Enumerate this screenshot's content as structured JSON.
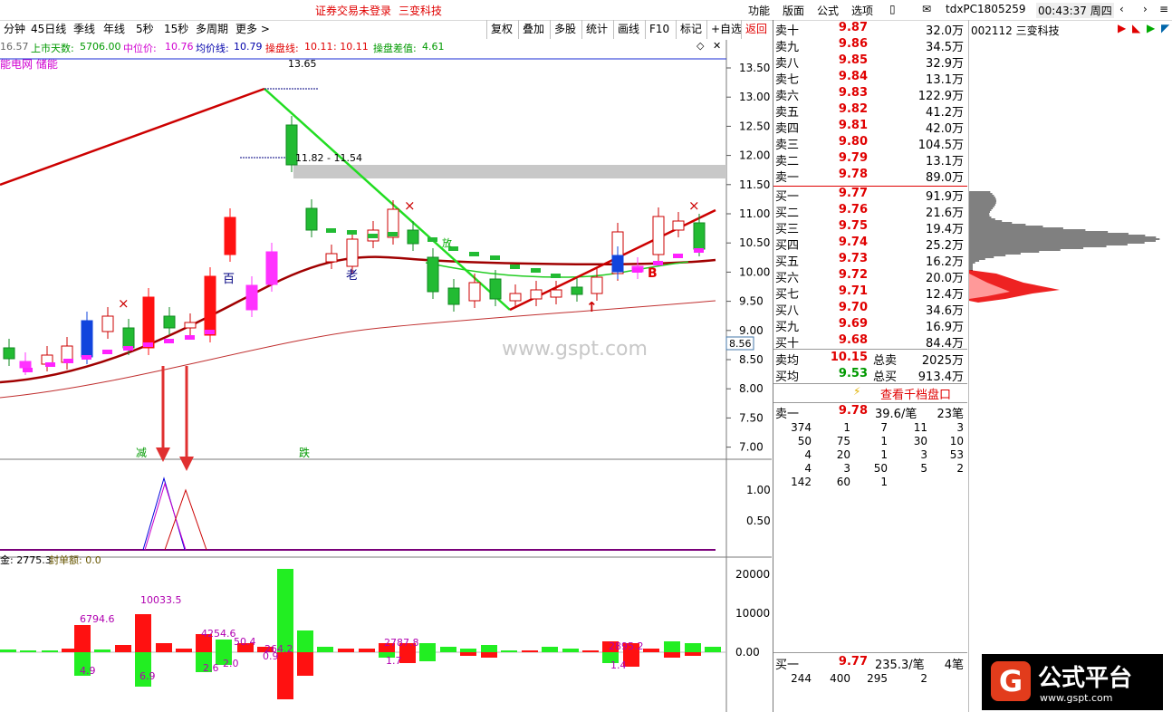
{
  "topbar": {
    "center_left": "证券交易未登录",
    "center_right": "三变科技",
    "menus": [
      "功能",
      "版面",
      "公式",
      "选项"
    ],
    "device_id": "tdxPC1805259",
    "clock": "00:43:37 周四"
  },
  "periods": [
    "分钟",
    "45日线",
    "季线",
    "年线",
    "5秒",
    "15秒",
    "多周期",
    "更多 >"
  ],
  "tools": [
    "复权",
    "叠加",
    "多股",
    "统计",
    "画线",
    "F10",
    "标记",
    "+自选",
    "返回"
  ],
  "info": {
    "price_prefix": "16.57",
    "days_label": "上市天数:",
    "days_value": "5706.00",
    "mid_label": "中位价:",
    "mid_value": "10.76",
    "avg_label": "均价线:",
    "avg_value": "10.79",
    "line_label": "操盘线:",
    "line_value": "10.11",
    "line_value2": ": 10.11",
    "diff_label": "操盘差值:",
    "diff_value": "4.61",
    "sector": "能电网 储能"
  },
  "chart": {
    "y_ticks": [
      "13.50",
      "13.00",
      "12.50",
      "12.00",
      "11.50",
      "11.00",
      "10.50",
      "10.00",
      "9.50",
      "9.00",
      "8.50",
      "8.00",
      "7.50",
      "7.00"
    ],
    "hi_label": "13.65",
    "range_label": "11.82 - 11.54",
    "current_price_tag": "8.56",
    "watermark": "www.gspt.com",
    "marks": {
      "bai": "百",
      "lao": "老",
      "b": "B",
      "fang": "放",
      "jian": "减",
      "die": "跌",
      "x": "×",
      "up": "↑"
    },
    "ind_ticks": [
      "1.00",
      "0.50"
    ],
    "vol_label_a": "金: 2775.3",
    "vol_label_b": "封单额: 0.0",
    "vol_ticks": [
      "20000",
      "10000",
      "0.00"
    ],
    "vol_values": [
      "6794.6",
      "10033.5",
      "4254.6",
      "50.4",
      "264.2",
      "2787.8",
      "2895.2",
      "4.9",
      "6.9",
      "2.6",
      "2.0",
      "0.9",
      "1.7",
      "1.4"
    ]
  },
  "book": {
    "code": "002112 三变科技",
    "sells": [
      {
        "name": "卖十",
        "price": "9.87",
        "vol": "32.0万"
      },
      {
        "name": "卖九",
        "price": "9.86",
        "vol": "34.5万"
      },
      {
        "name": "卖八",
        "price": "9.85",
        "vol": "32.9万"
      },
      {
        "name": "卖七",
        "price": "9.84",
        "vol": "13.1万"
      },
      {
        "name": "卖六",
        "price": "9.83",
        "vol": "122.9万"
      },
      {
        "name": "卖五",
        "price": "9.82",
        "vol": "41.2万"
      },
      {
        "name": "卖四",
        "price": "9.81",
        "vol": "42.0万"
      },
      {
        "name": "卖三",
        "price": "9.80",
        "vol": "104.5万"
      },
      {
        "name": "卖二",
        "price": "9.79",
        "vol": "13.1万"
      },
      {
        "name": "卖一",
        "price": "9.78",
        "vol": "89.0万"
      }
    ],
    "buys": [
      {
        "name": "买一",
        "price": "9.77",
        "vol": "91.9万"
      },
      {
        "name": "买二",
        "price": "9.76",
        "vol": "21.6万"
      },
      {
        "name": "买三",
        "price": "9.75",
        "vol": "19.4万"
      },
      {
        "name": "买四",
        "price": "9.74",
        "vol": "25.2万"
      },
      {
        "name": "买五",
        "price": "9.73",
        "vol": "16.2万"
      },
      {
        "name": "买六",
        "price": "9.72",
        "vol": "20.0万"
      },
      {
        "name": "买七",
        "price": "9.71",
        "vol": "12.4万"
      },
      {
        "name": "买八",
        "price": "9.70",
        "vol": "34.6万"
      },
      {
        "name": "买九",
        "price": "9.69",
        "vol": "16.9万"
      },
      {
        "name": "买十",
        "price": "9.68",
        "vol": "84.4万"
      }
    ],
    "sell_avg_label": "卖均",
    "sell_avg": "10.15",
    "sell_total_label": "总卖",
    "sell_total": "2025万",
    "buy_avg_label": "买均",
    "buy_avg": "9.53",
    "buy_total_label": "总买",
    "buy_total": "913.4万",
    "thousand_link": "查看千档盘口",
    "ask1_label": "卖一",
    "ask1_price": "9.78",
    "ask1_per": "39.6/笔",
    "ask1_count": "23笔",
    "ask_queue": [
      [
        "374",
        "1",
        "7",
        "11",
        "3"
      ],
      [
        "50",
        "75",
        "1",
        "30",
        "10"
      ],
      [
        "4",
        "20",
        "1",
        "3",
        "53"
      ],
      [
        "4",
        "3",
        "50",
        "5",
        "2"
      ],
      [
        "142",
        "60",
        "1",
        "",
        ""
      ]
    ],
    "bid1_label": "买一",
    "bid1_price": "9.77",
    "bid1_per": "235.3/笔",
    "bid1_count": "4笔",
    "bid_queue": [
      [
        "244",
        "400",
        "295",
        "2",
        ""
      ]
    ]
  },
  "logo": {
    "text": "公式平台",
    "url_text": "www.gspt.com"
  },
  "colors": {
    "up": "#ff0000",
    "down": "#00dd00",
    "magenta": "#ff00ff",
    "blue": "#0000cc"
  }
}
